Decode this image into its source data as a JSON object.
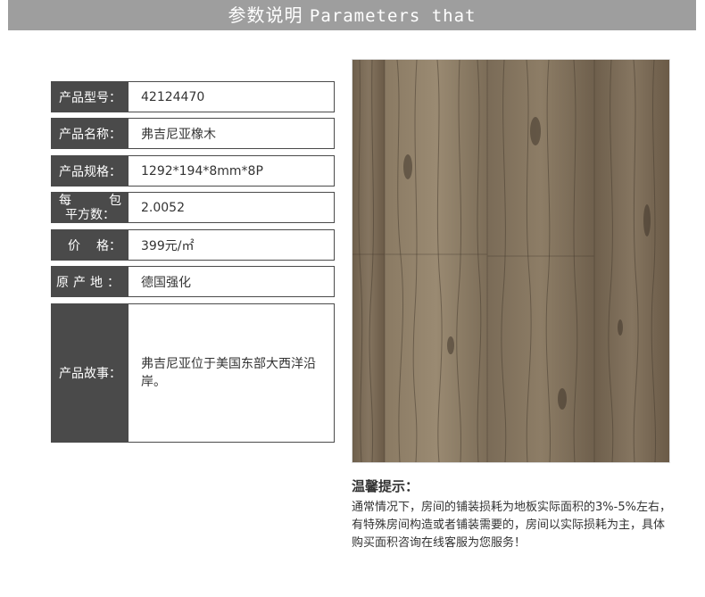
{
  "banner": {
    "cn": "参数说明",
    "en": "Parameters that"
  },
  "params": [
    {
      "label": "产品型号：",
      "value": "42124470"
    },
    {
      "label": "产品名称：",
      "value": "弗吉尼亚橡木"
    },
    {
      "label": "产品规格：",
      "value": "1292*194*8mm*8P"
    },
    {
      "label_a": "每",
      "label_b": "包",
      "label_c": "平方数：",
      "value": "2.0052"
    },
    {
      "label_a": "价",
      "label_b": "格：",
      "value": "399元/㎡"
    },
    {
      "label": "原产地：",
      "value": "德国强化"
    },
    {
      "label": "产品故事：",
      "value": "弗吉尼亚位于美国东部大西洋沿岸。"
    }
  ],
  "image": {
    "icon": "wood-floor-sample-image"
  },
  "tips": {
    "title": "温馨提示：",
    "body": "通常情况下，房间的铺装损耗为地板实际面积的3%-5%左右，有特殊房间构造或者铺装需要的，房间以实际损耗为主，具体购买面积咨询在线客服为您服务！"
  }
}
